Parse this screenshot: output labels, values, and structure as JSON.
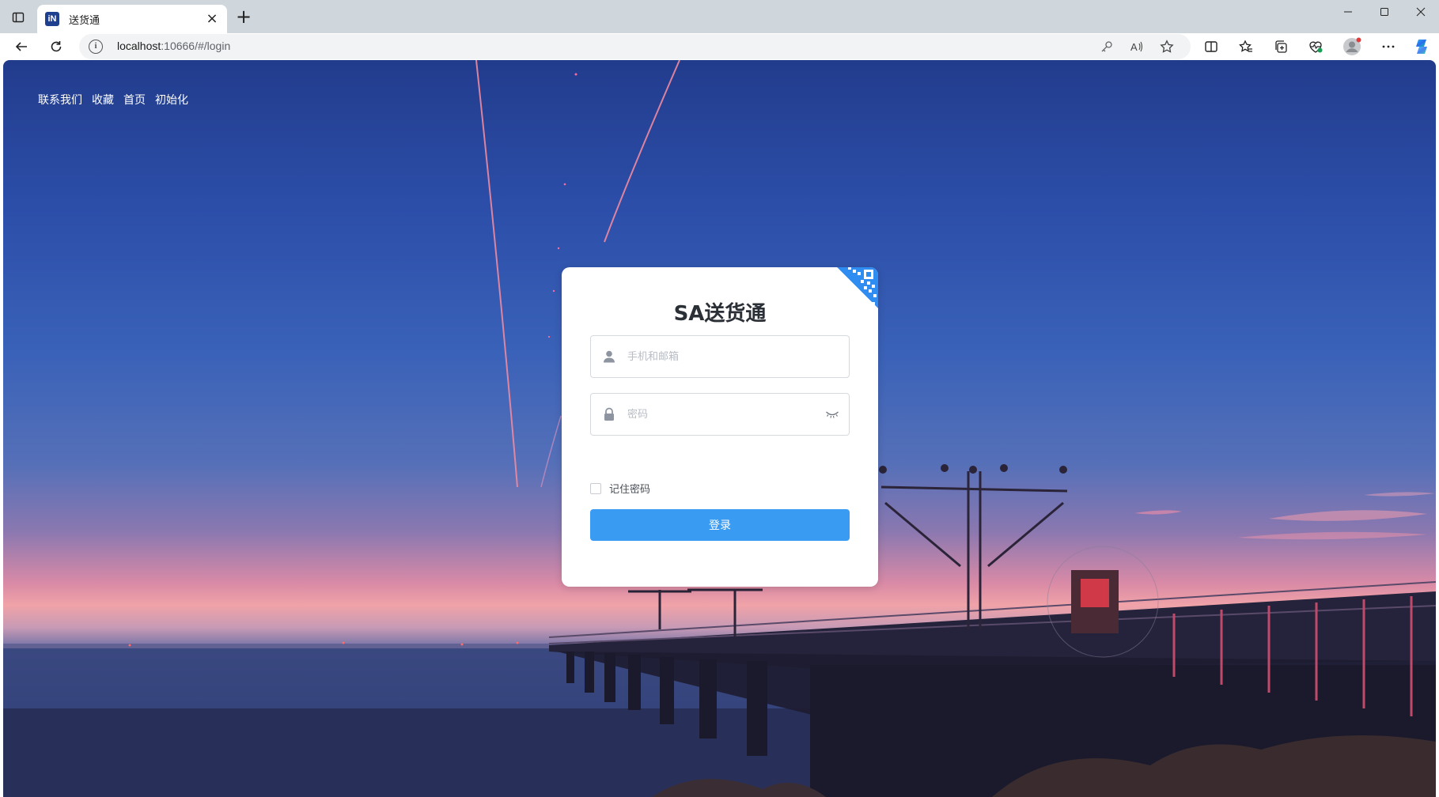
{
  "browser": {
    "tab_title": "送货通",
    "favicon_text": "iN",
    "url_host": "localhost",
    "url_rest": ":10666/#/login",
    "icons": [
      "tab-actions-icon",
      "close-icon",
      "new-tab-icon",
      "minimize-icon",
      "maximize-icon",
      "close-window-icon",
      "back-icon",
      "refresh-icon",
      "info-icon",
      "key-icon",
      "read-aloud-icon",
      "star-icon",
      "split-screen-icon",
      "favorites-icon",
      "collections-icon",
      "browser-essentials-icon",
      "profile-avatar",
      "more-icon",
      "copilot-icon"
    ]
  },
  "page": {
    "top_links": [
      "联系我们",
      "收藏",
      "首页",
      "初始化"
    ]
  },
  "login": {
    "title": "SA送货通",
    "username_placeholder": "手机和邮箱",
    "password_placeholder": "密码",
    "remember_label": "记住密码",
    "submit_label": "登录"
  },
  "colors": {
    "primary_button": "#3a9bf3",
    "qr_accent": "#2f8cf0"
  }
}
